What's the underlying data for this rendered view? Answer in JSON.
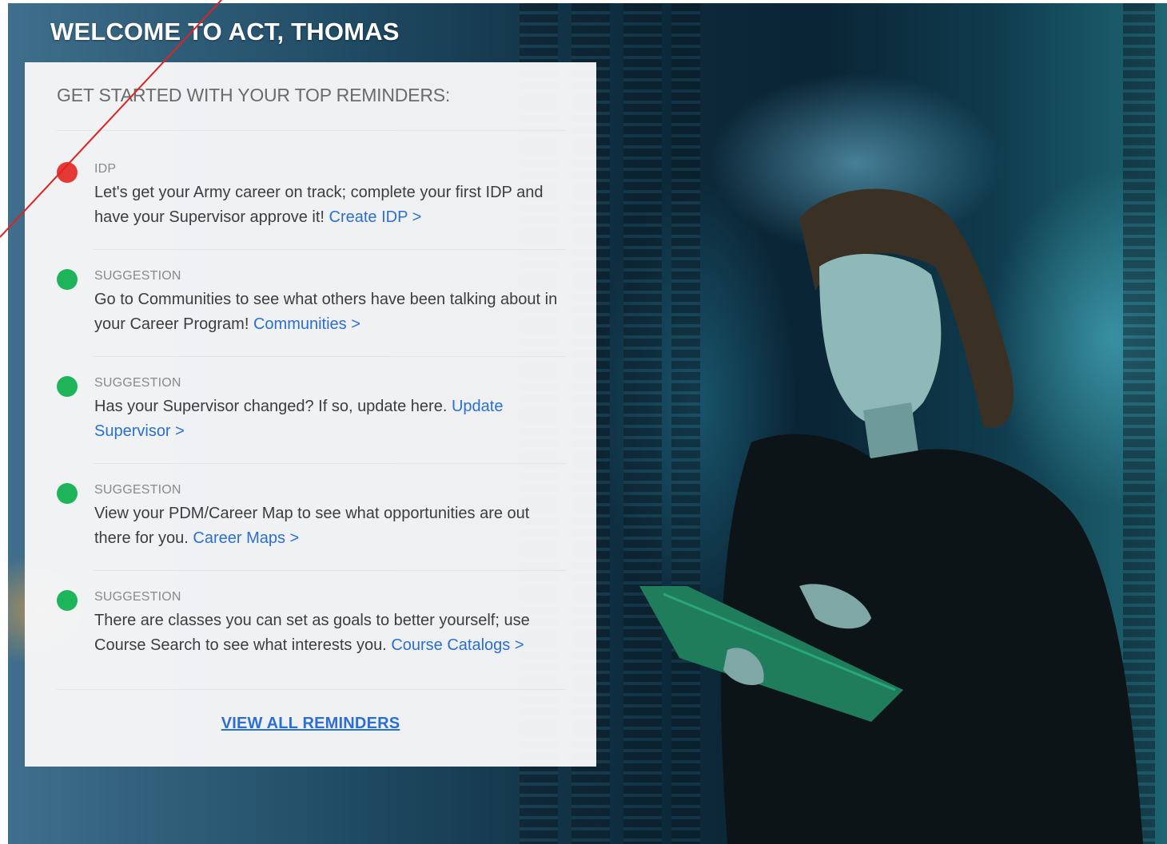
{
  "welcome": {
    "title": "WELCOME TO ACT, THOMAS"
  },
  "panel": {
    "heading": "GET STARTED WITH YOUR TOP REMINDERS:",
    "reminders": [
      {
        "status_color": "#e53935",
        "tag": "IDP",
        "text": "Let's get your Army career on track; complete your first IDP and have your Supervisor approve it!",
        "link": "Create IDP >"
      },
      {
        "status_color": "#1eb45a",
        "tag": "SUGGESTION",
        "text": "Go to Communities to see what others have been talking about in your Career Program!",
        "link": "Communities >"
      },
      {
        "status_color": "#1eb45a",
        "tag": "SUGGESTION",
        "text": "Has your Supervisor changed? If so, update here.",
        "link": "Update Supervisor >"
      },
      {
        "status_color": "#1eb45a",
        "tag": "SUGGESTION",
        "text": "View your PDM/Career Map to see what opportunities are out there for you.",
        "link": "Career Maps >"
      },
      {
        "status_color": "#1eb45a",
        "tag": "SUGGESTION",
        "text": "There are classes you can set as goals to better yourself; use Course Search to see what interests you.",
        "link": "Course Catalogs >"
      }
    ],
    "view_all_label": "VIEW ALL REMINDERS"
  },
  "colors": {
    "link": "#2c6fcf",
    "panel_bg": "#f8f8f9",
    "alert": "#e53935",
    "ok": "#1eb45a"
  }
}
